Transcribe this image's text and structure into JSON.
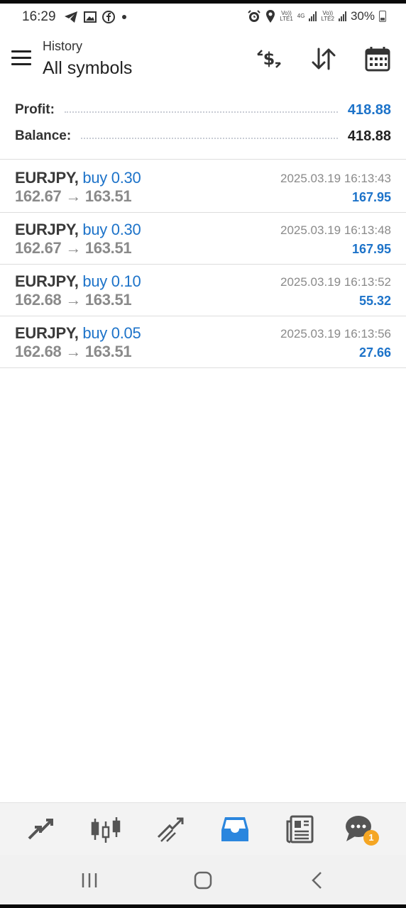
{
  "status_bar": {
    "time": "16:29",
    "battery": "30%",
    "net_top_1": "Vo))",
    "net_bot_1": "LTE1",
    "net_top_2": "4G",
    "net_top_3": "Vo))",
    "net_bot_3": "LTE2"
  },
  "header": {
    "subtitle": "History",
    "title": "All symbols"
  },
  "summary": {
    "profit_label": "Profit:",
    "profit_value": "418.88",
    "balance_label": "Balance:",
    "balance_value": "418.88"
  },
  "trades": [
    {
      "symbol": "EURJPY,",
      "side": "buy 0.30",
      "open": "162.67",
      "close": "163.51",
      "time": "2025.03.19 16:13:43",
      "profit": "167.95"
    },
    {
      "symbol": "EURJPY,",
      "side": "buy 0.30",
      "open": "162.67",
      "close": "163.51",
      "time": "2025.03.19 16:13:48",
      "profit": "167.95"
    },
    {
      "symbol": "EURJPY,",
      "side": "buy 0.10",
      "open": "162.68",
      "close": "163.51",
      "time": "2025.03.19 16:13:52",
      "profit": "55.32"
    },
    {
      "symbol": "EURJPY,",
      "side": "buy 0.05",
      "open": "162.68",
      "close": "163.51",
      "time": "2025.03.19 16:13:56",
      "profit": "27.66"
    }
  ],
  "arrow": "→",
  "tabs": [
    "quotes-tab",
    "chart-tab",
    "trade-tab",
    "history-tab",
    "news-tab",
    "chat-tab"
  ],
  "chat_badge": "1",
  "colors": {
    "accent": "#1d73c9",
    "badge": "#f5a623",
    "muted_text": "#8a8a8a"
  }
}
